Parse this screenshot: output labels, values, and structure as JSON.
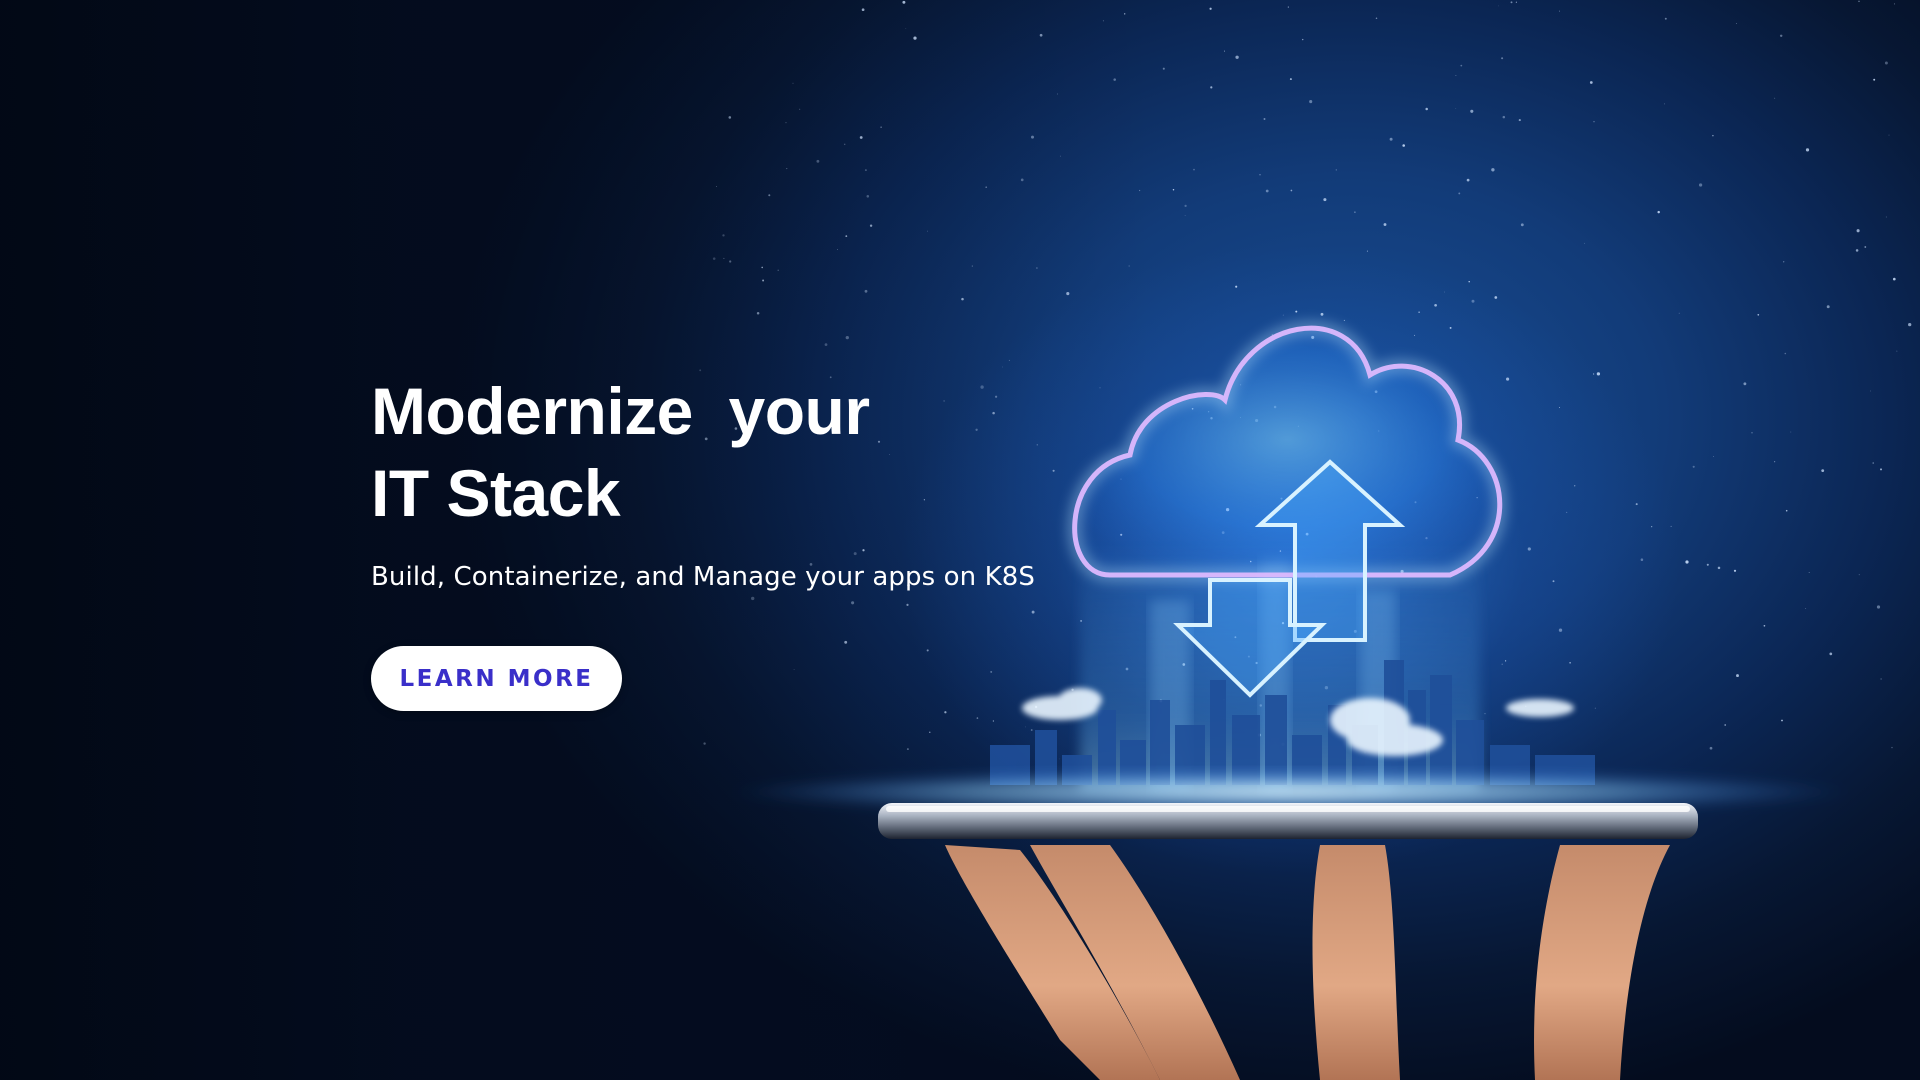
{
  "hero": {
    "headline_line1": "Modernize  your",
    "headline_line2": "IT Stack",
    "subheadline": "Build, Containerize, and Manage your apps on K8S",
    "cta_label": "LEARN MORE"
  },
  "colors": {
    "background": "#06122a",
    "headline": "#ffffff",
    "cta_background": "#ffffff",
    "cta_text": "#3a2fc9",
    "glow": "#4096ff"
  },
  "illustration": {
    "icons": [
      "cloud-icon",
      "upload-arrow-icon",
      "download-arrow-icon",
      "smartphone",
      "hand",
      "city-skyline"
    ]
  }
}
